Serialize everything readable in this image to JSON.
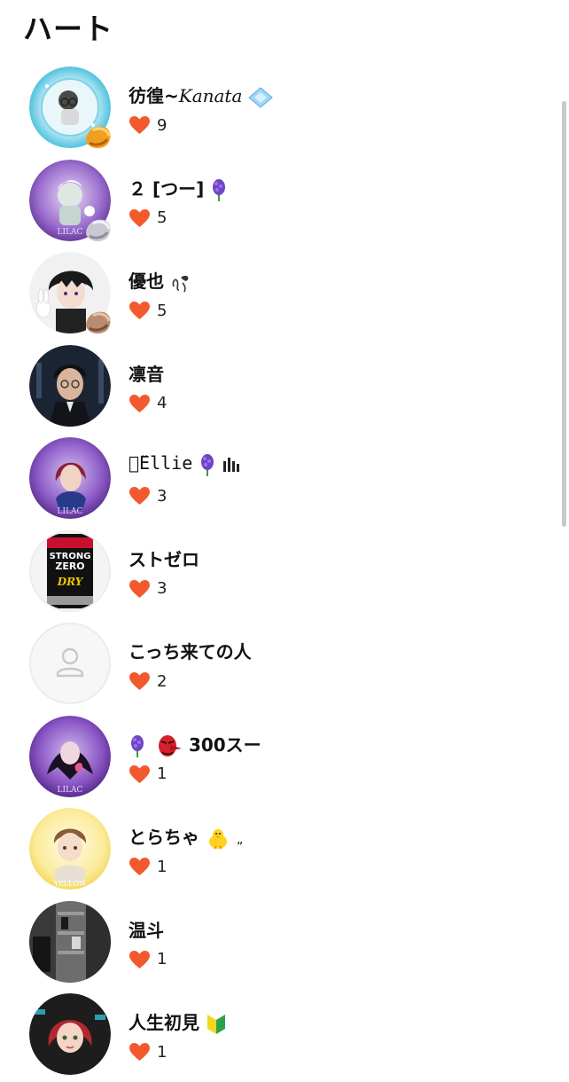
{
  "page": {
    "title": "ハート"
  },
  "colors": {
    "heart": "#f2592d",
    "text": "#111111",
    "placeholder_bg": "#f7f7f7",
    "placeholder_icon": "#c8c8c8"
  },
  "users": [
    {
      "name": "彷徨~",
      "name_italic": "Kanata",
      "count": "9",
      "avatar": "blue-frame-avatar",
      "badge": "orange-badge-icon",
      "trail_icon": "blue-diamond-icon"
    },
    {
      "name": "２ [つー]",
      "count": "5",
      "avatar": "lilac-frame-avatar",
      "badge": "silver-badge-icon",
      "trail_icon": "hyacinth-icon"
    },
    {
      "name": "優也",
      "count": "5",
      "avatar": "dark-hair-anime-avatar",
      "badge": "bronze-badge-icon",
      "trail_icon": "ribbon-kiss-icon"
    },
    {
      "name": "凛音",
      "count": "4",
      "avatar": "suit-man-avatar"
    },
    {
      "name": "ꂚ̈Ellie",
      "count": "3",
      "avatar": "lilac-frame-avatar",
      "trail_icon": "hyacinth-icon",
      "trail_icon_2": "bars-icon"
    },
    {
      "name": "ストゼロ",
      "count": "3",
      "avatar": "strong-zero-can-avatar",
      "avatar_text_1": "STRONG",
      "avatar_text_2": "ZERO",
      "avatar_text_3": "DRY"
    },
    {
      "name": "こっち来ての人",
      "count": "2",
      "avatar": "default-person-avatar"
    },
    {
      "name": "300スー",
      "count": "1",
      "avatar": "lilac-frame-avatar",
      "lead_icon": "hyacinth-icon",
      "lead_icon_2": "tengu-mask-icon"
    },
    {
      "name": "とらちゃ",
      "count": "1",
      "avatar": "yellow-frame-avatar",
      "trail_icon": "chick-icon",
      "trail_text": "„"
    },
    {
      "name": "温斗",
      "count": "1",
      "avatar": "shelf-photo-avatar"
    },
    {
      "name": "人生初見",
      "count": "1",
      "avatar": "red-hair-anime-avatar",
      "trail_icon": "beginner-mark-icon"
    }
  ]
}
